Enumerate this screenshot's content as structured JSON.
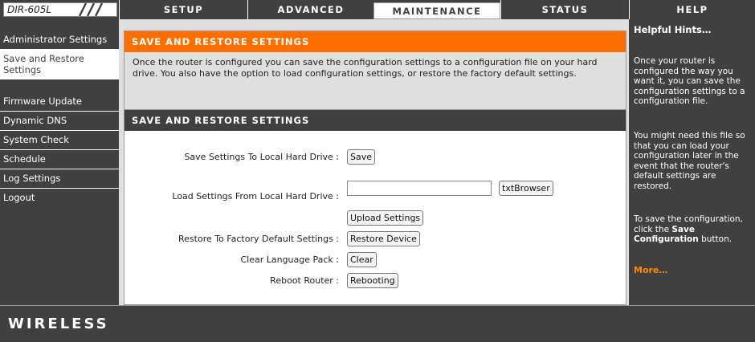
{
  "header": {
    "model": "DIR-605L",
    "tabs": [
      {
        "label": "SETUP"
      },
      {
        "label": "ADVANCED"
      },
      {
        "label": "MAINTENANCE"
      },
      {
        "label": "STATUS"
      },
      {
        "label": "HELP"
      }
    ],
    "active_tab": "MAINTENANCE"
  },
  "sidebar": {
    "items": [
      {
        "label": "Administrator Settings"
      },
      {
        "label": "Save and Restore Settings"
      },
      {
        "label": "Firmware Update"
      },
      {
        "label": "Dynamic DNS"
      },
      {
        "label": "System Check"
      },
      {
        "label": "Schedule"
      },
      {
        "label": "Log Settings"
      },
      {
        "label": "Logout"
      }
    ],
    "active_item": "Save and Restore Settings"
  },
  "intro": {
    "title": "SAVE AND RESTORE SETTINGS",
    "text": "Once the router is configured you can save the configuration settings to a configuration file on your hard drive. You also have the option to load configuration settings, or restore the factory default settings."
  },
  "form": {
    "title": "SAVE AND RESTORE SETTINGS",
    "save_label": "Save Settings To Local Hard Drive :",
    "save_button": "Save",
    "load_label": "Load Settings From Local Hard Drive :",
    "file_value": "",
    "browse_button": "txtBrowser",
    "upload_button": "Upload Settings",
    "restore_label": "Restore To Factory Default Settings :",
    "restore_button": "Restore Device",
    "clear_label": "Clear Language Pack :",
    "clear_button": "Clear",
    "reboot_label": "Reboot Router :",
    "reboot_button": "Rebooting"
  },
  "hints": {
    "title": "Helpful Hints…",
    "p1": "Once your router is configured the way you want it, you can save the configuration settings to a configuration file.",
    "p2": "You might need this file so that you can load your configuration later in the event that the router's default settings are restored.",
    "p3_prefix": "To save the configuration, click the ",
    "p3_bold": "Save Configuration",
    "p3_suffix": " button.",
    "more": "More…"
  },
  "footer": {
    "label": "WIRELESS"
  },
  "colors": {
    "dark_bg": "#404040",
    "accent_orange": "#ff6f00",
    "panel_gray": "#dfdfdf"
  }
}
